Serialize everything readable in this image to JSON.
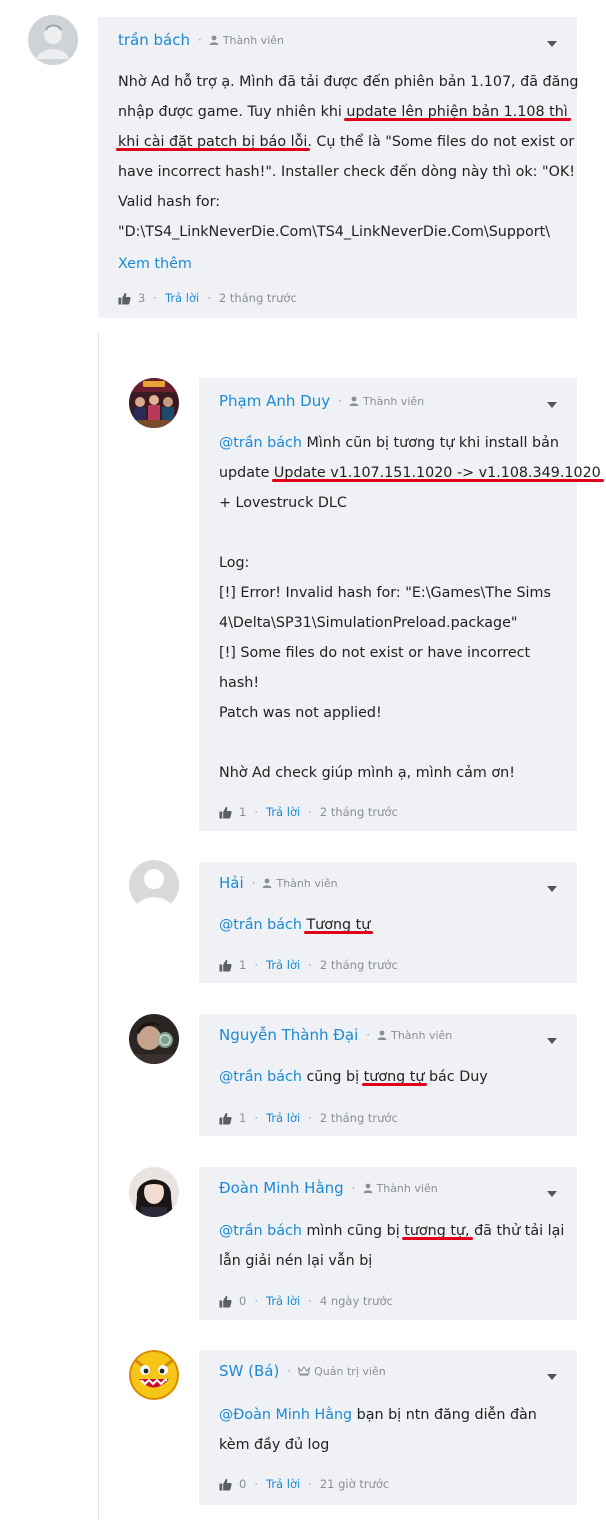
{
  "comments": {
    "c1": {
      "author": "trần bách",
      "role": "Thành viên",
      "lines": [
        "Nhờ Ad hỗ trợ ạ. Mình đã tải được đến phiên bản 1.107, đã đăng",
        "nhập được game. Tuy nhiên khi ",
        "update lên phiện bản 1.108 thì",
        "khi cài đặt patch bị báo lỗi",
        ". Cụ thể là \"Some files do not exist or",
        "have incorrect hash!\". Installer check đến dòng này thì ok: \"OK!",
        "Valid hash for:",
        "\"D:\\TS4_LinkNeverDie.Com\\TS4_LinkNeverDie.Com\\Support\\"
      ],
      "more": "Xem thêm",
      "likes": "3",
      "reply": "Trả lời",
      "time": "2 tháng trước"
    },
    "c2": {
      "author": "Phạm Anh Duy",
      "role": "Thành viên",
      "mention": "@trần bách",
      "l1": " Mình cũn bị tương tự khi install bản",
      "l2a": "update ",
      "l2b": "Update v1.107.151.1020 -> v1.108.349.1020",
      "lines": [
        "+ Lovestruck DLC",
        "",
        "Log:",
        "[!] Error! Invalid hash for: \"E:\\Games\\The Sims",
        "4\\Delta\\SP31\\SimulationPreload.package\"",
        "[!] Some files do not exist or have incorrect",
        "hash!",
        "Patch was not applied!",
        "",
        "Nhờ Ad check giúp mình ạ, mình cảm ơn!"
      ],
      "likes": "1",
      "reply": "Trả lời",
      "time": "2 tháng trước"
    },
    "c3": {
      "author": "Hải",
      "role": "Thành viên",
      "mention": "@trần bách",
      "t1": "Tương tự",
      "likes": "1",
      "reply": "Trả lời",
      "time": "2 tháng trước"
    },
    "c4": {
      "author": "Nguyễn Thành Đại",
      "role": "Thành viên",
      "mention": "@trần bách",
      "t1": " cũng bị ",
      "t2": "tương tự",
      "t3": " bác Duy",
      "likes": "1",
      "reply": "Trả lời",
      "time": "2 tháng trước"
    },
    "c5": {
      "author": "Đoàn Minh Hằng",
      "role": "Thành viên",
      "mention": "@trần bách",
      "t1": " mình cũng bị ",
      "t2": "tương tự,",
      "t3": " đã thử tải lại",
      "l2": "lẫn giải nén lại vẫn bị",
      "likes": "0",
      "reply": "Trả lời",
      "time": "4 ngày trước"
    },
    "c6": {
      "author": "SW (Bá)",
      "role": "Quản trị viên",
      "mention": "@Đoàn Minh Hằng",
      "t1": " bạn bị ntn đăng diễn đàn",
      "l2": "kèm đầy đủ log",
      "likes": "0",
      "reply": "Trả lời",
      "time": "21 giờ trước"
    }
  },
  "colors": {
    "link": "#1a8ad6",
    "bubble": "#f0f1f4",
    "underline": "#e0001b",
    "meta": "#8a8f96"
  },
  "icons": {
    "member": "user-icon",
    "admin": "crown-icon",
    "like": "thumbs-up-icon",
    "menu": "chevron-down-icon"
  }
}
